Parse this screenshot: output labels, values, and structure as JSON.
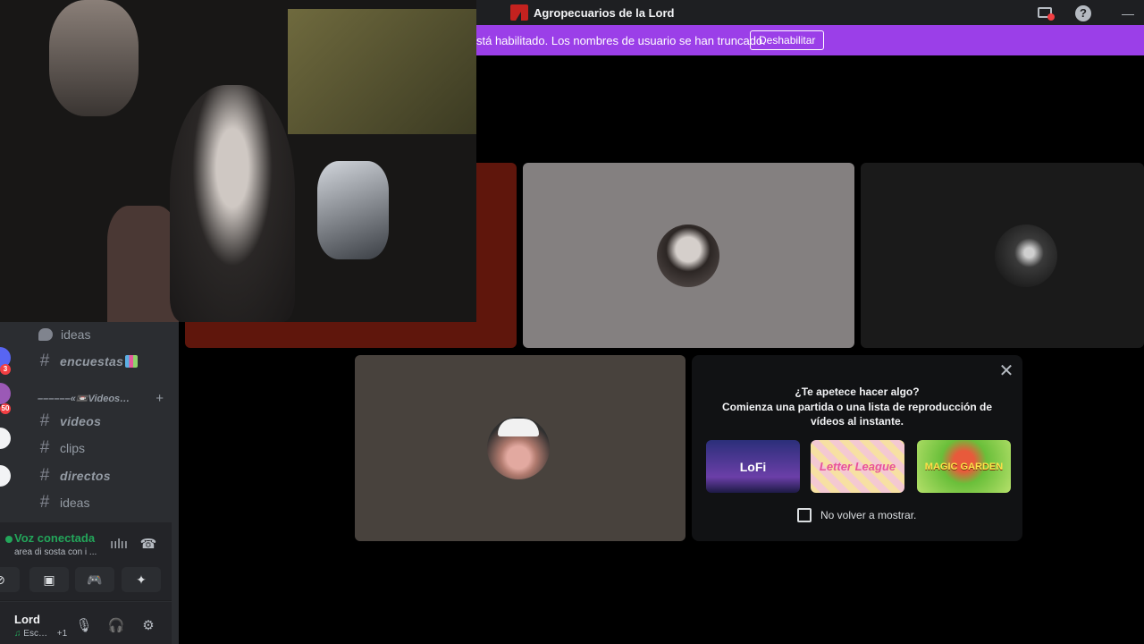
{
  "window": {
    "title": "Agropecuarios de la Lord"
  },
  "notice": {
    "text": "stá habilitado. Los nombres de usuario se han truncado.",
    "button_label": "Deshabilitar"
  },
  "guild_badges": [
    "3",
    "50"
  ],
  "channels": {
    "ideas_top": "ideas",
    "encuestas": "encuestas",
    "category": "––––––«📼Videos…",
    "videos": "videos",
    "clips": "clips",
    "directos": "directos",
    "ideas_bottom": "ideas"
  },
  "voice_panel": {
    "status": "Voz conectada",
    "channel": "area di sosta con i ..."
  },
  "user_panel": {
    "name": "Lord",
    "status": "Esc…",
    "extra": "+1"
  },
  "activity": {
    "title": "¿Te apetece hacer algo?",
    "subtitle": "Comienza una partida o una lista de reproducción de vídeos al instante.",
    "games": [
      {
        "label": "LoFi",
        "icon": "lofi-game-icon"
      },
      {
        "label": "Letter League",
        "icon": "letter-league-game-icon"
      },
      {
        "label": "MAGIC GARDEN",
        "icon": "magic-garden-game-icon"
      }
    ],
    "checkbox_label": "No volver a mostrar."
  },
  "icons": {
    "screen_share": "screen-share-icon",
    "help": "help-icon",
    "minimize": "minimize-icon",
    "close": "close-icon",
    "mic": "microphone-icon",
    "headphones": "headphones-icon",
    "settings": "gear-icon"
  },
  "colors": {
    "notice_bg": "#9b3fe8",
    "voice_connected": "#23a55a",
    "badge": "#f23f43",
    "titlebar": "#1e1f22",
    "sidebar": "#2b2d31"
  }
}
